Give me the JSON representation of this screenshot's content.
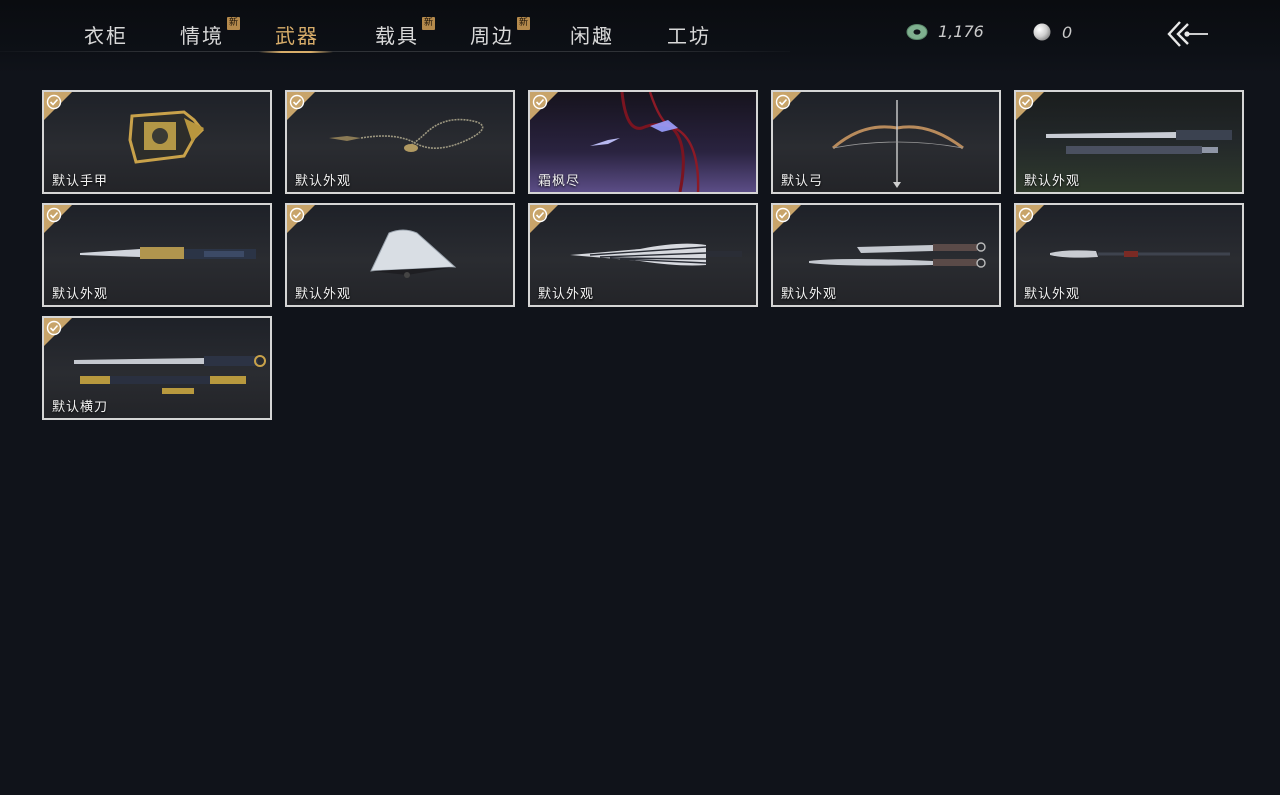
{
  "tabs": [
    {
      "label": "衣柜",
      "is_new": false,
      "active": false
    },
    {
      "label": "情境",
      "is_new": true,
      "active": false
    },
    {
      "label": "武器",
      "is_new": false,
      "active": true
    },
    {
      "label": "载具",
      "is_new": true,
      "active": false
    },
    {
      "label": "周边",
      "is_new": true,
      "active": false
    },
    {
      "label": "闲趣",
      "is_new": false,
      "active": false
    },
    {
      "label": "工坊",
      "is_new": false,
      "active": false
    }
  ],
  "new_badge_text": "新",
  "currency": {
    "jade": {
      "value": "1,176",
      "icon": "jade-coin-icon"
    },
    "pearl": {
      "value": "0",
      "icon": "pearl-icon"
    }
  },
  "back_button": {
    "icon": "back-arrow-icon"
  },
  "accent_color": "#d8ad6a",
  "items": [
    {
      "label": "默认手甲",
      "owned": true,
      "icon": "gauntlet-icon"
    },
    {
      "label": "默认外观",
      "owned": true,
      "icon": "rope-dart-icon"
    },
    {
      "label": "霜枫尽",
      "owned": true,
      "icon": "rope-dart-red-icon"
    },
    {
      "label": "默认弓",
      "owned": true,
      "icon": "bow-icon"
    },
    {
      "label": "默认外观",
      "owned": true,
      "icon": "sword-and-scabbard-icon"
    },
    {
      "label": "默认外观",
      "owned": true,
      "icon": "dagger-icon"
    },
    {
      "label": "默认外观",
      "owned": true,
      "icon": "fan-icon"
    },
    {
      "label": "默认外观",
      "owned": true,
      "icon": "umbrella-icon"
    },
    {
      "label": "默认外观",
      "owned": true,
      "icon": "twin-sabres-icon"
    },
    {
      "label": "默认外观",
      "owned": true,
      "icon": "spear-icon"
    },
    {
      "label": "默认横刀",
      "owned": true,
      "icon": "hengdao-icon"
    }
  ]
}
